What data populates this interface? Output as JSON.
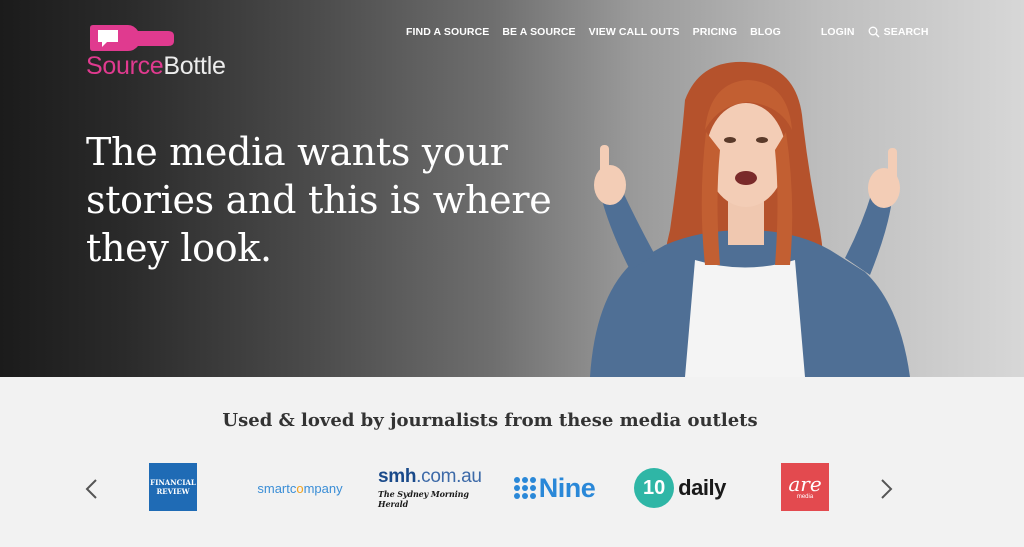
{
  "brand": {
    "source": "Source",
    "bottle": "Bottle"
  },
  "nav": {
    "find_source": "FIND A SOURCE",
    "be_source": "BE A SOURCE",
    "call_outs": "VIEW CALL OUTS",
    "pricing": "PRICING",
    "blog": "BLOG",
    "login": "LOGIN",
    "search": "SEARCH"
  },
  "hero": {
    "headline_1": "The media wants your",
    "headline_2": "stories and this is where",
    "headline_3": "they look."
  },
  "outlets": {
    "title": "Used & loved by journalists from these media outlets",
    "afr_1": "FINANCIAL",
    "afr_2": "REVIEW",
    "smartcompany_a": "smartc",
    "smartcompany_o": "o",
    "smartcompany_b": "mpany",
    "smh_a": "smh",
    "smh_b": ".com.au",
    "smh_sub": "The Sydney Morning Herald",
    "nine": "Nine",
    "ten": "10",
    "daily": "daily",
    "are": "are",
    "are_sub": "media"
  },
  "colors": {
    "brand_pink": "#e03a8f",
    "nine_blue": "#2a88d8",
    "ten_teal": "#2fb6a6",
    "are_red": "#e34a4f",
    "afr_blue": "#1f6bb5"
  },
  "icons": {
    "search": "search-icon",
    "prev": "chevron-left-icon",
    "next": "chevron-right-icon"
  }
}
